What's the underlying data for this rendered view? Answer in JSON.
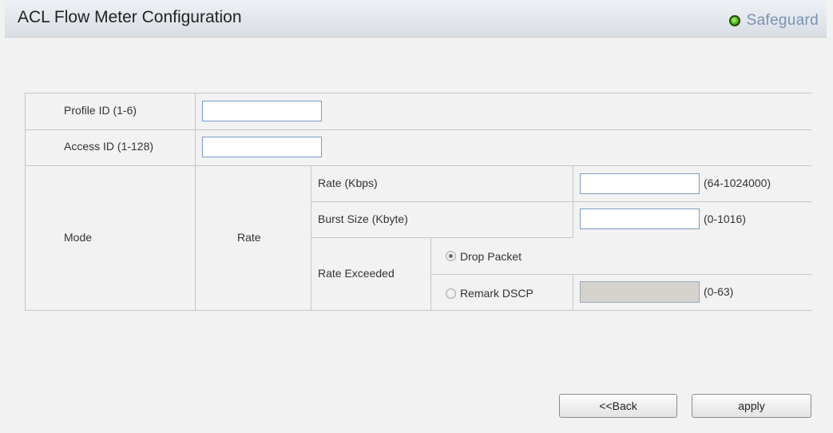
{
  "header": {
    "title": "ACL Flow Meter Configuration",
    "safeguard_label": "Safeguard"
  },
  "form": {
    "profile_id_label": "Profile ID (1-6)",
    "profile_id_value": "",
    "access_id_label": "Access ID (1-128)",
    "access_id_value": "",
    "mode_label": "Mode",
    "rate_label": "Rate",
    "rate_kbps_label": "Rate (Kbps)",
    "rate_kbps_value": "",
    "rate_kbps_range": "(64-1024000)",
    "burst_size_label": "Burst Size (Kbyte)",
    "burst_size_value": "",
    "burst_size_range": "(0-1016)",
    "rate_exceeded_label": "Rate Exceeded",
    "drop_packet_label": "Drop Packet",
    "drop_packet_selected": true,
    "remark_dscp_label": "Remark DSCP",
    "remark_dscp_selected": false,
    "remark_dscp_value": "",
    "remark_dscp_range": "(0-63)"
  },
  "buttons": {
    "back_label": "<<Back",
    "apply_label": "apply"
  }
}
